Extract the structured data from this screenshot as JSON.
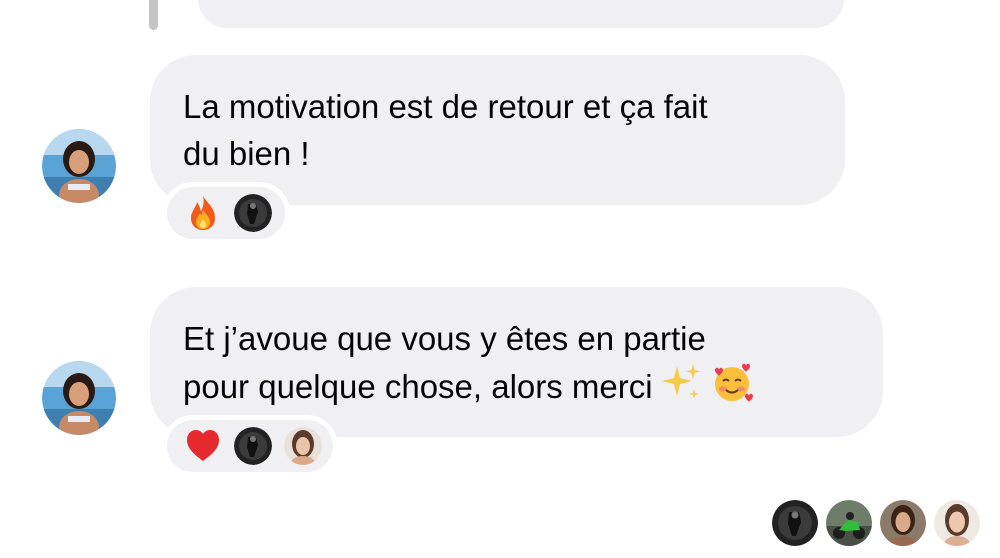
{
  "messages": [
    {
      "lines": [
        "La motivation est de retour et ça fait",
        "du bien !"
      ],
      "reactions": [
        "fire-emoji",
        "reactor-dark-avatar"
      ]
    },
    {
      "lines": [
        "Et j’avoue que vous y êtes en partie",
        "pour quelque chose, alors merci"
      ],
      "inline_emojis": [
        "sparkles-emoji",
        "smiling-face-with-hearts-emoji"
      ],
      "reactions": [
        "red-heart-emoji",
        "reactor-dark-avatar",
        "reactor-woman-avatar"
      ]
    }
  ],
  "seen_by": [
    "dark-avatar",
    "motorcycle-avatar",
    "woman-avatar",
    "light-woman-avatar"
  ],
  "colors": {
    "bubble": "#f0f0f2",
    "text": "#050505",
    "background": "#ffffff",
    "scrollbar": "#c4c4c6"
  }
}
